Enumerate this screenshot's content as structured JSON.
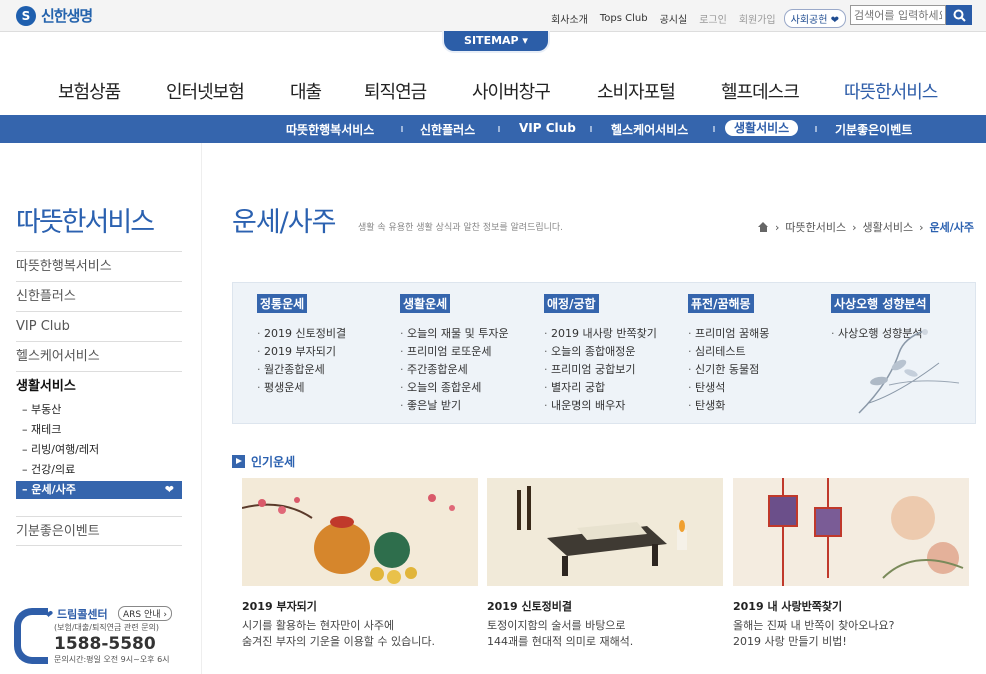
{
  "brand": {
    "name": "신한생명",
    "logo_mark": "S"
  },
  "util_menu": [
    "회사소개",
    "Tops Club",
    "공시실"
  ],
  "util_login": [
    "로그인",
    "회원가입"
  ],
  "social_label": "사회공헌 ❤",
  "search": {
    "placeholder": "검색어를 입력하세요",
    "icon": "search-icon"
  },
  "sitemap_label": "SITEMAP ▾",
  "gnb": [
    "보험상품",
    "인터넷보험",
    "대출",
    "퇴직연금",
    "사이버창구",
    "소비자포털",
    "헬프데스크",
    "따뜻한서비스"
  ],
  "subnav": [
    "따뜻한행복서비스",
    "신한플러스",
    "VIP Club",
    "헬스케어서비스",
    "생활서비스",
    "기분좋은이벤트"
  ],
  "lnb": {
    "title": "따뜻한서비스",
    "items": [
      "따뜻한행복서비스",
      "신한플러스",
      "VIP Club",
      "헬스케어서비스"
    ],
    "active_title": "생활서비스",
    "sub_items": [
      "부동산",
      "재테크",
      "리빙/여행/레저",
      "건강/의료",
      "운세/사주"
    ],
    "last_item": "기분좋은이벤트"
  },
  "call_center": {
    "title": "❤ 드림콜센터",
    "ars": "ARS 안내 ›",
    "desc": "(보험/대출/퇴직연금 관련 문의)",
    "number": "1588-5580",
    "hours": "문의시간:평일 오전 9시~오후 6시"
  },
  "page": {
    "title": "운세/사주",
    "desc": "생활 속 유용한 생활 상식과 알찬 정보를 알려드립니다.",
    "breadcrumb": [
      "따뜻한서비스",
      "생활서비스",
      "운세/사주"
    ]
  },
  "categories": [
    {
      "title": "정통운세",
      "items": [
        "2019 신토정비결",
        "2019 부자되기",
        "월간종합운세",
        "평생운세"
      ]
    },
    {
      "title": "생활운세",
      "items": [
        "오늘의 재물 및 투자운",
        "프리미엄 로또운세",
        "주간종합운세",
        "오늘의 종합운세",
        "좋은날 받기"
      ]
    },
    {
      "title": "애정/궁합",
      "items": [
        "2019 내사랑 반쪽찾기",
        "오늘의 종합애정운",
        "프리미엄 궁합보기",
        "별자리 궁합",
        "내운명의 배우자"
      ]
    },
    {
      "title": "퓨전/꿈해몽",
      "items": [
        "프리미엄 꿈해몽",
        "심리테스트",
        "신기한 동물점",
        "탄생석",
        "탄생화"
      ]
    },
    {
      "title": "사상오행 성향분석",
      "items": [
        "사상오행 성향분석"
      ]
    }
  ],
  "popular_title": "인기운세",
  "cards": [
    {
      "title": "2019 부자되기",
      "desc1": "시기를 활용하는 현자만이 사주에",
      "desc2": "숨겨진 부자의 기운을 이용할 수 있습니다."
    },
    {
      "title": "2019 신토정비결",
      "desc1": "토정이지함의 술서를 바탕으로",
      "desc2": "144괘를 현대적 의미로 재해석."
    },
    {
      "title": "2019 내 사랑반쪽찾기",
      "desc1": "올해는 진짜 내 반쪽이 찾아오나요?",
      "desc2": "2019 사랑 만들기 비법!"
    }
  ],
  "colors": {
    "brand_blue": "#3565ad",
    "title_blue": "#2b61b0"
  }
}
